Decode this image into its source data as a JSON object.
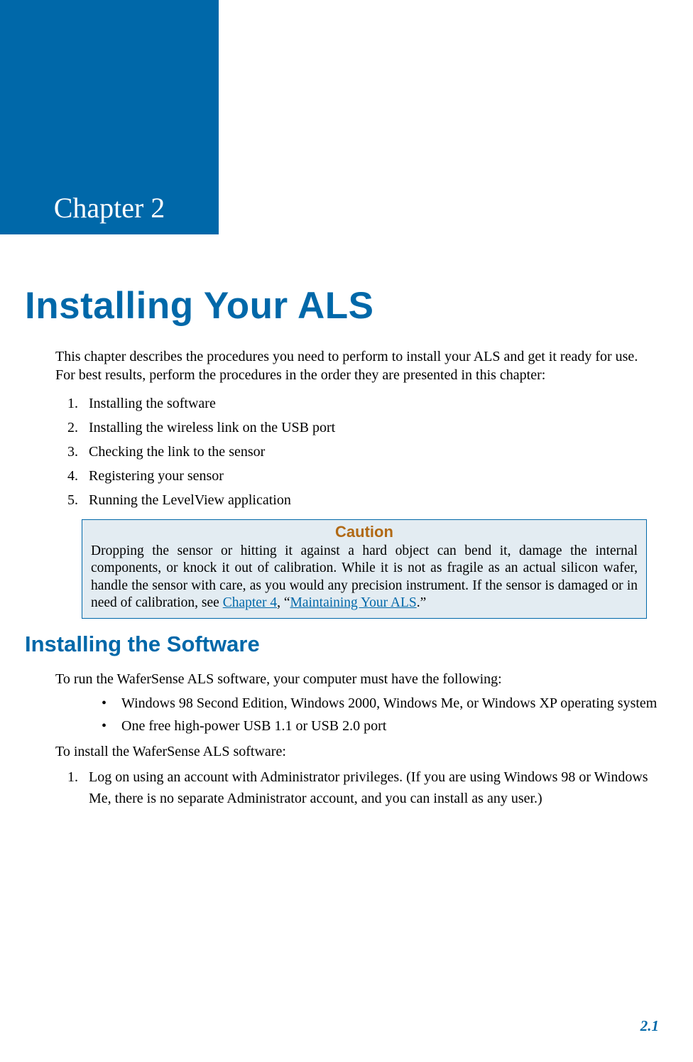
{
  "chapter": {
    "badge": "Chapter 2",
    "title": "Installing Your ALS"
  },
  "intro": "This chapter describes the procedures you need to perform to install your ALS and get it ready for use. For best results, perform the procedures in the order they are presented in this chapter:",
  "steps": {
    "s1": "Installing the software",
    "s2": "Installing the wireless link on the USB port",
    "s3": "Checking the link to the sensor",
    "s4": "Registering your sensor",
    "s5": "Running the LevelView application"
  },
  "caution": {
    "title": "Caution",
    "text_before": "Dropping the sensor or hitting it against a hard object can bend it, damage the internal components, or knock it out of calibration. While it is not as fragile as an actual silicon wafer, handle the sensor with care, as you would any precision instrument. If the sensor is damaged or in need of calibration, see ",
    "link1": "Chapter 4",
    "mid": ", “",
    "link2": "Maintaining Your ALS",
    "after": ".”"
  },
  "section": {
    "title": "Installing the Software",
    "req_intro": "To run the WaferSense ALS software, your computer must have the following:",
    "req1": "Windows 98 Second Edition, Windows 2000, Windows Me, or Windows XP operating system",
    "req2": "One free high-power USB 1.1 or USB 2.0 port",
    "install_intro": "To install the WaferSense ALS software:",
    "install_step1": "Log on using an account with Administrator privileges. (If you are using Windows 98 or Windows Me, there is no separate Administrator account, and you can install as any user.)"
  },
  "page_number": "2.1"
}
